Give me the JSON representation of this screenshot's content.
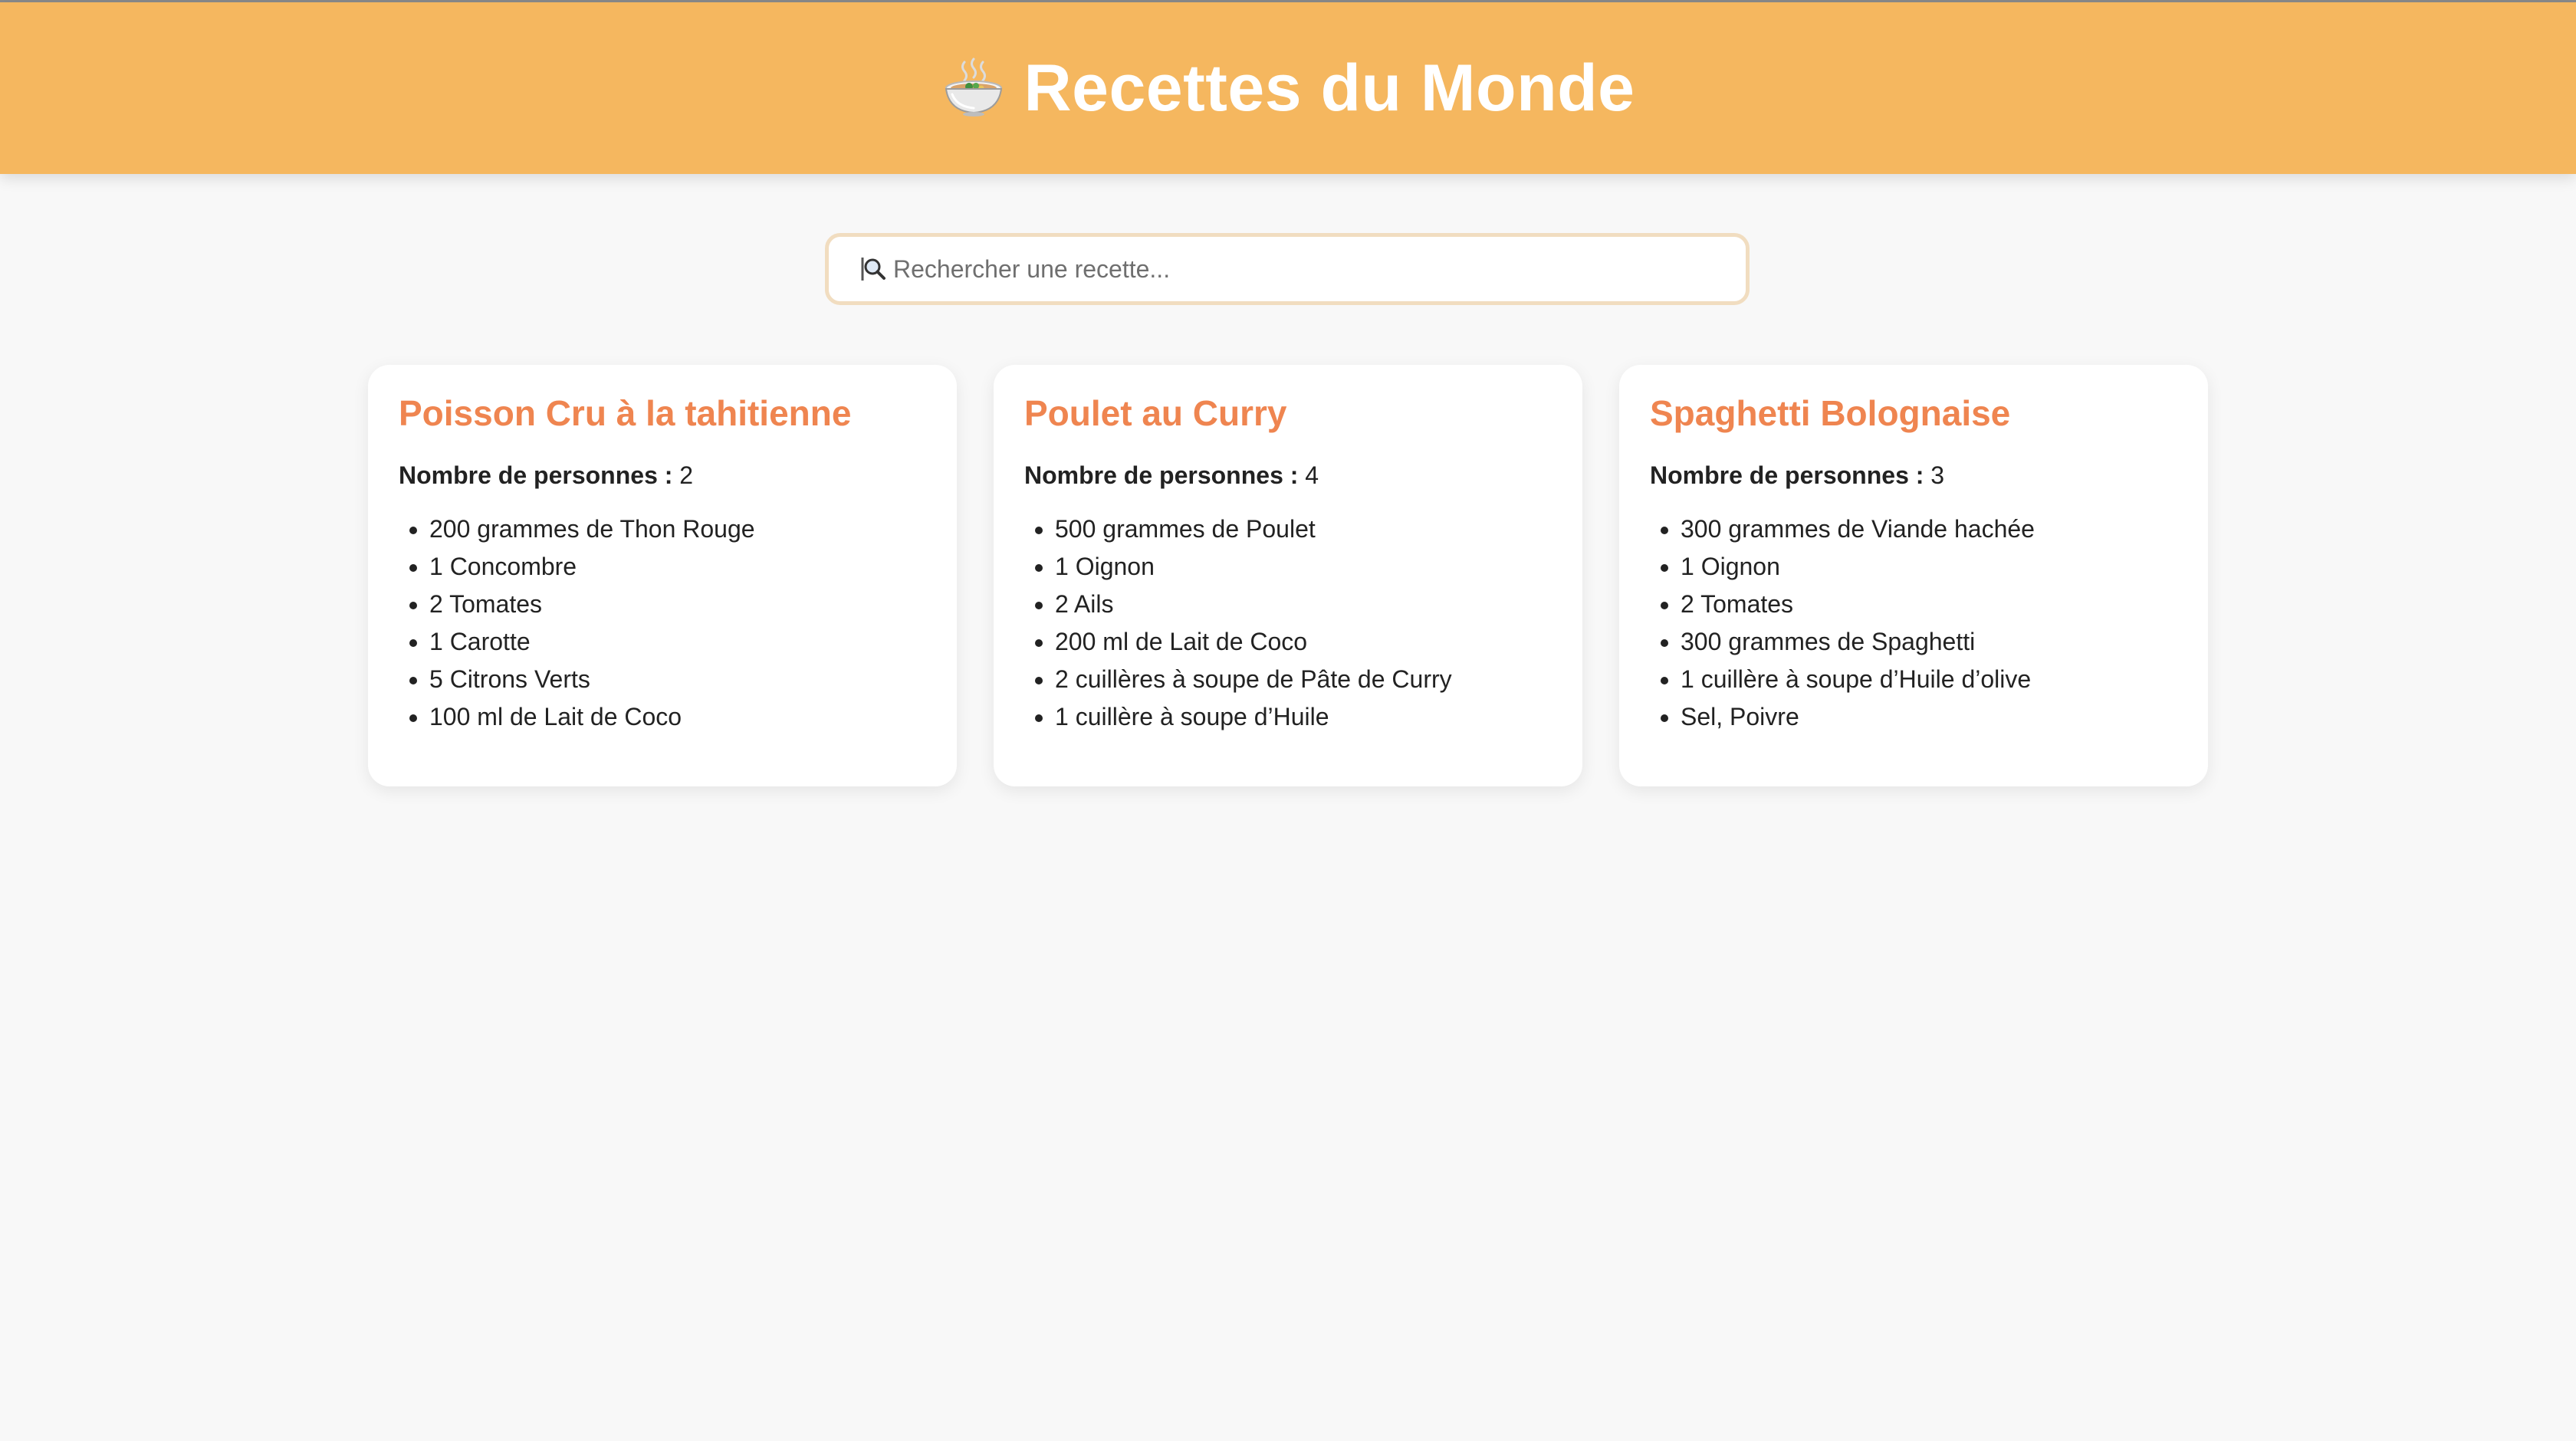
{
  "header": {
    "title": "Recettes du Monde",
    "icon": "bowl-with-steam-icon",
    "background": "#f5b75f"
  },
  "search": {
    "icon": "magnifier-icon",
    "placeholder": "Rechercher une recette...",
    "value": ""
  },
  "accent": "#ef8550",
  "recipes": [
    {
      "title": "Poisson Cru à la tahitienne",
      "servings_label": "Nombre de personnes :",
      "servings": "2",
      "ingredients": [
        "200 grammes de Thon Rouge",
        "1 Concombre",
        "2 Tomates",
        "1 Carotte",
        "5 Citrons Verts",
        "100 ml de Lait de Coco"
      ]
    },
    {
      "title": "Poulet au Curry",
      "servings_label": "Nombre de personnes :",
      "servings": "4",
      "ingredients": [
        "500 grammes de Poulet",
        "1 Oignon",
        "2 Ails",
        "200 ml de Lait de Coco",
        "2 cuillères à soupe de Pâte de Curry",
        "1 cuillère à soupe d’Huile"
      ]
    },
    {
      "title": "Spaghetti Bolognaise",
      "servings_label": "Nombre de personnes :",
      "servings": "3",
      "ingredients": [
        "300 grammes de Viande hachée",
        "1 Oignon",
        "2 Tomates",
        "300 grammes de Spaghetti",
        "1 cuillère à soupe d’Huile d’olive",
        "Sel, Poivre"
      ]
    }
  ]
}
